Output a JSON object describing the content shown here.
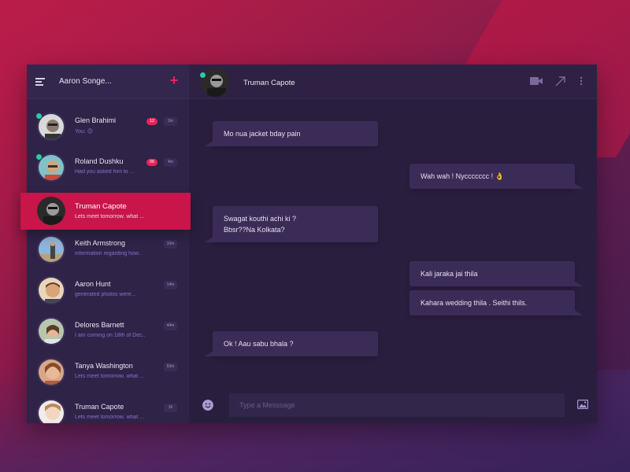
{
  "sidebar": {
    "title": "Aaron Songe...",
    "contacts": [
      {
        "name": "Glen Brahimi",
        "preview": "You: 😊",
        "badge": "12",
        "time": "2m",
        "online": true
      },
      {
        "name": "Roland Dushku",
        "preview": "Had you asked him to ...",
        "badge": "06",
        "time": "4m",
        "online": true
      },
      {
        "name": "Truman Capote",
        "preview": "Lets meet tomorrow. what ...",
        "badge": "",
        "time": "",
        "online": false
      },
      {
        "name": "Keith Armstrong",
        "preview": "information regarding how..",
        "badge": "",
        "time": "10m",
        "online": false
      },
      {
        "name": "Aaron Hunt",
        "preview": "generated photos were...",
        "badge": "",
        "time": "14m",
        "online": false
      },
      {
        "name": "Delores Barnett",
        "preview": "I am coming on 18th of Dec..",
        "badge": "",
        "time": "44m",
        "online": false
      },
      {
        "name": "Tanya Washington",
        "preview": "Lets meet tomorrow. what ...",
        "badge": "",
        "time": "53m",
        "online": false
      },
      {
        "name": "Truman Capote",
        "preview": "Lets meet tomorrow. what ...",
        "badge": "",
        "time": "1h",
        "online": false
      }
    ]
  },
  "active": {
    "name": "Truman Capote",
    "preview": "Lets meet tomorrow. what ..."
  },
  "chat": {
    "title": "Truman Capote",
    "messages": [
      {
        "dir": "in",
        "text": "Mo nua jacket bday pain"
      },
      {
        "dir": "out",
        "text": "Wah wah ! Nyccccccc ! 👌"
      },
      {
        "dir": "in",
        "line1": "Swagat kouthi achi ki ?",
        "line2": "Bbsr??Na Kolkata?"
      },
      {
        "dir": "out",
        "text": "Kali jaraka jai thila"
      },
      {
        "dir": "out",
        "text": "Kahara wedding thila . Seithi thils."
      },
      {
        "dir": "in",
        "text": "Ok ! Aau sabu bhala ?"
      }
    ],
    "composer_placeholder": "Type a Messsage"
  },
  "colors": {
    "accent": "#c8154a",
    "online": "#2bc9a4",
    "bubble": "#3b2c57"
  }
}
